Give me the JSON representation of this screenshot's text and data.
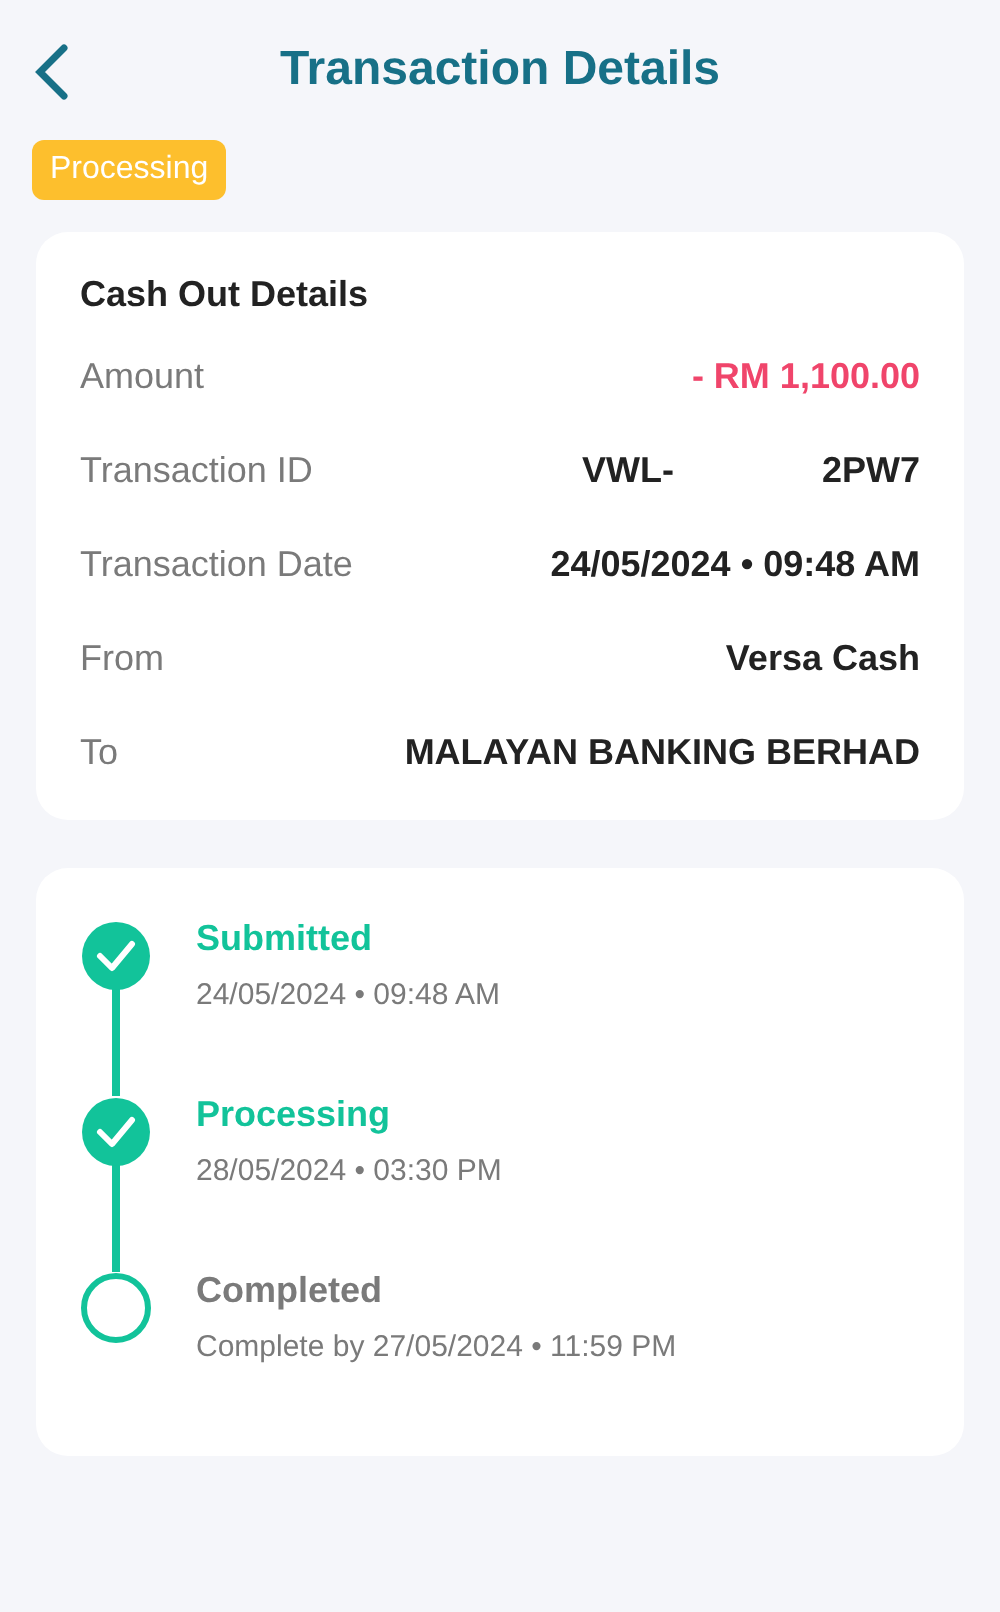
{
  "header": {
    "title": "Transaction Details"
  },
  "status_badge": "Processing",
  "details": {
    "title": "Cash Out Details",
    "rows": [
      {
        "label": "Amount",
        "value": "- RM 1,100.00",
        "kind": "negative"
      },
      {
        "label": "Transaction ID",
        "value_parts": [
          "VWL-",
          "2PW7"
        ],
        "kind": "masked"
      },
      {
        "label": "Transaction Date",
        "value": "24/05/2024 • 09:48 AM",
        "kind": "plain"
      },
      {
        "label": "From",
        "value": "Versa Cash",
        "kind": "plain"
      },
      {
        "label": "To",
        "value": "MALAYAN BANKING BERHAD",
        "kind": "plain"
      }
    ]
  },
  "timeline": [
    {
      "title": "Submitted",
      "time": "24/05/2024 • 09:48 AM",
      "done": true
    },
    {
      "title": "Processing",
      "time": "28/05/2024 • 03:30 PM",
      "done": true
    },
    {
      "title": "Completed",
      "time": "Complete by 27/05/2024 • 11:59 PM",
      "done": false
    }
  ]
}
